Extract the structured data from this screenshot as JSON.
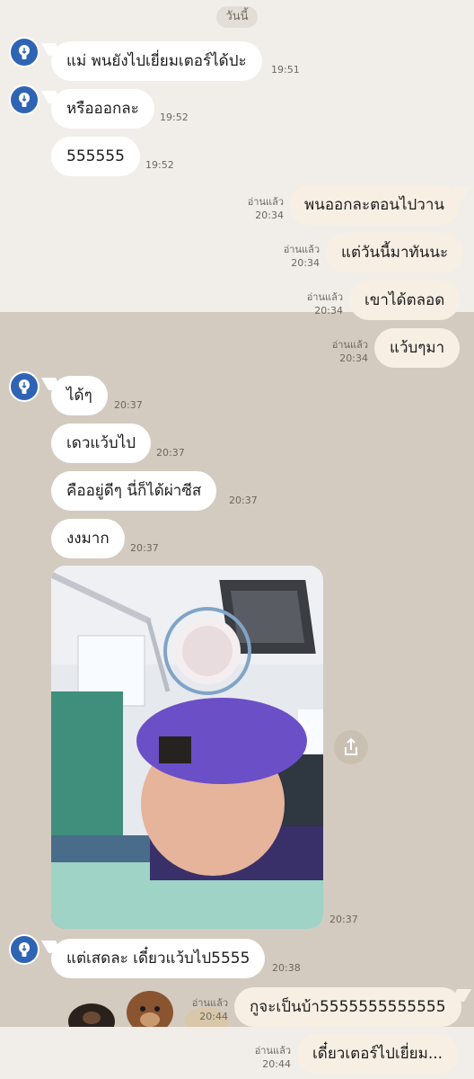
{
  "date_divider": "วันนี้",
  "incoming": [
    {
      "text": "แม่ พนยังไปเยี่ยมเตอร์ได้ปะ",
      "time": "19:51"
    },
    {
      "text": "หรือออกละ",
      "time": "19:52"
    },
    {
      "text": "555555",
      "time": "19:52"
    },
    {
      "text": "ได้ๆ",
      "time": "20:37"
    },
    {
      "text": "เดวแว้บไป",
      "time": "20:37"
    },
    {
      "text": "คืออยู่ดีๆ นี่ก็ได้ผ่าซีส",
      "time": "20:37"
    },
    {
      "text": "งงมาก",
      "time": "20:37"
    },
    {
      "text": "แต่เสดละ เดี๋ยวแว้บไป5555",
      "time": "20:38"
    }
  ],
  "photo_message": {
    "time": "20:37",
    "icon": "share-icon"
  },
  "outgoing": [
    {
      "text": "พนออกละตอนไปวาน",
      "read": "อ่านแล้ว",
      "time": "20:34"
    },
    {
      "text": "แต่วันนี้มาทันนะ",
      "read": "อ่านแล้ว",
      "time": "20:34"
    },
    {
      "text": "เขาได้ตลอด",
      "read": "อ่านแล้ว",
      "time": "20:34"
    },
    {
      "text": "แว้บๆมา",
      "read": "อ่านแล้ว",
      "time": "20:34"
    },
    {
      "text": "กูจะเป็นบ้า5555555555555",
      "read": "อ่านแล้ว",
      "time": "20:44"
    },
    {
      "text": "เดี๋ยวเตอร์ไปเยี่ยม...",
      "read": "อ่านแล้ว",
      "time": "20:44"
    }
  ],
  "colors": {
    "top_background": "#f1eee9",
    "chat_background": "#d3cbbf",
    "incoming_bubble": "#ffffff",
    "outgoing_bubble": "#f7efe4",
    "avatar": "#2f64b4"
  }
}
